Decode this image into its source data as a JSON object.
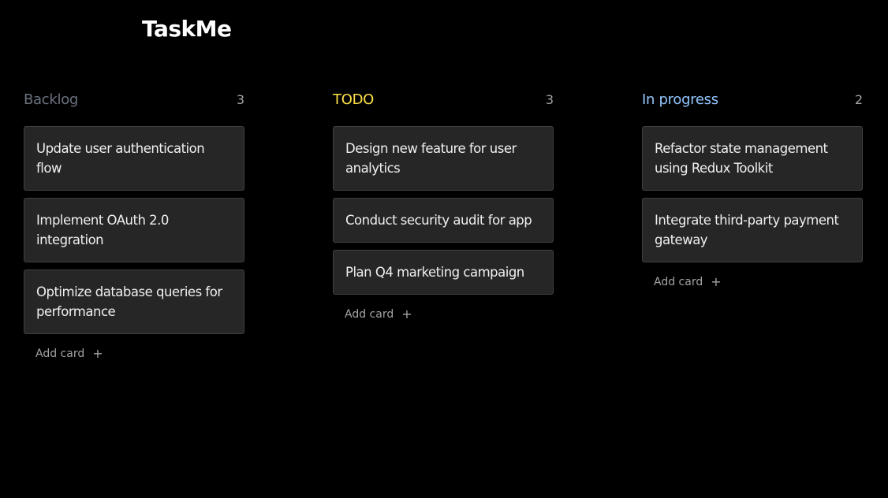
{
  "app": {
    "title": "TaskMe"
  },
  "columns": [
    {
      "title": "Backlog",
      "count": "3",
      "color": "#6b7280",
      "cards": [
        "Update user authentication flow",
        "Implement OAuth 2.0 integration",
        "Optimize database queries for performance"
      ],
      "add_label": "Add card",
      "add_icon": "plus-icon"
    },
    {
      "title": "TODO",
      "count": "3",
      "color": "#fde047",
      "cards": [
        "Design new feature for user analytics",
        "Conduct security audit for app",
        "Plan Q4 marketing campaign"
      ],
      "add_label": "Add card",
      "add_icon": "plus-icon"
    },
    {
      "title": "In progress",
      "count": "2",
      "color": "#93c5fd",
      "cards": [
        "Refactor state management using Redux Toolkit",
        "Integrate third-party payment gateway"
      ],
      "add_label": "Add card",
      "add_icon": "plus-icon"
    }
  ]
}
